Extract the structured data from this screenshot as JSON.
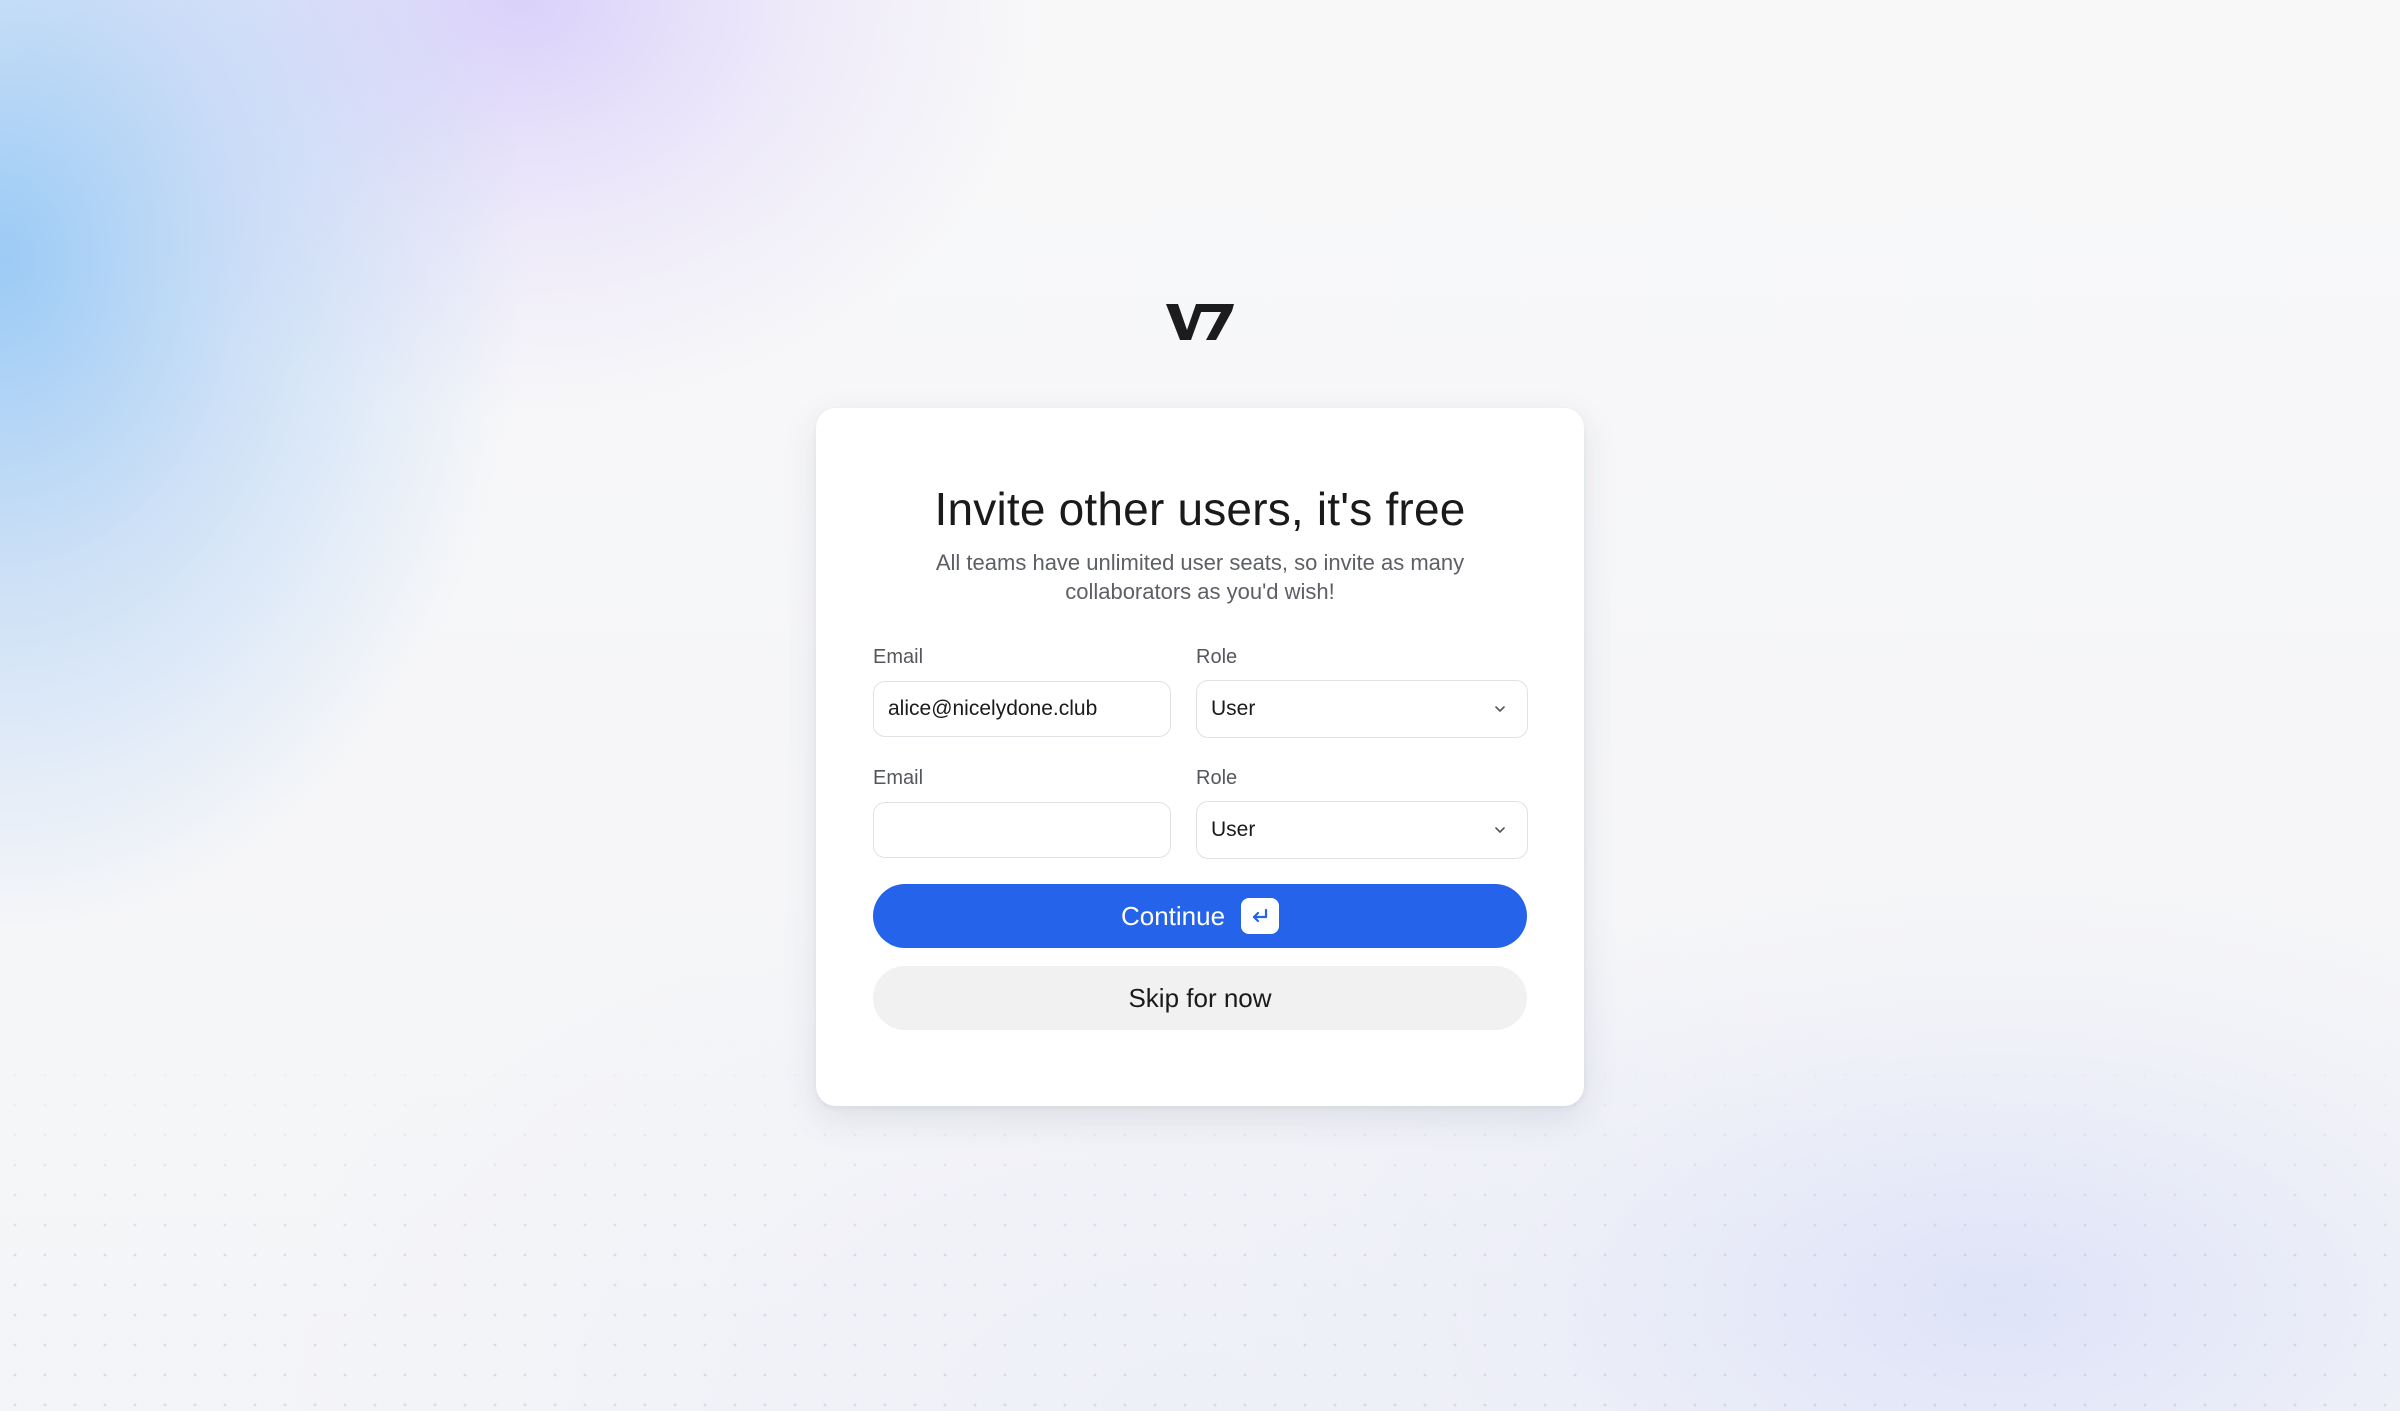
{
  "brand": {
    "logo_text": "V7",
    "accent_color": "#2563eb"
  },
  "invite": {
    "title": "Invite other users, it's free",
    "subtitle": "All teams have unlimited user seats, so invite as many collaborators as you'd wish!",
    "rows": [
      {
        "email_label": "Email",
        "email_value": "alice@nicelydone.club",
        "role_label": "Role",
        "role_value": "User"
      },
      {
        "email_label": "Email",
        "email_value": "",
        "role_label": "Role",
        "role_value": "User"
      }
    ],
    "continue_label": "Continue",
    "enter_key_icon": "enter-key-icon",
    "skip_label": "Skip for now"
  }
}
